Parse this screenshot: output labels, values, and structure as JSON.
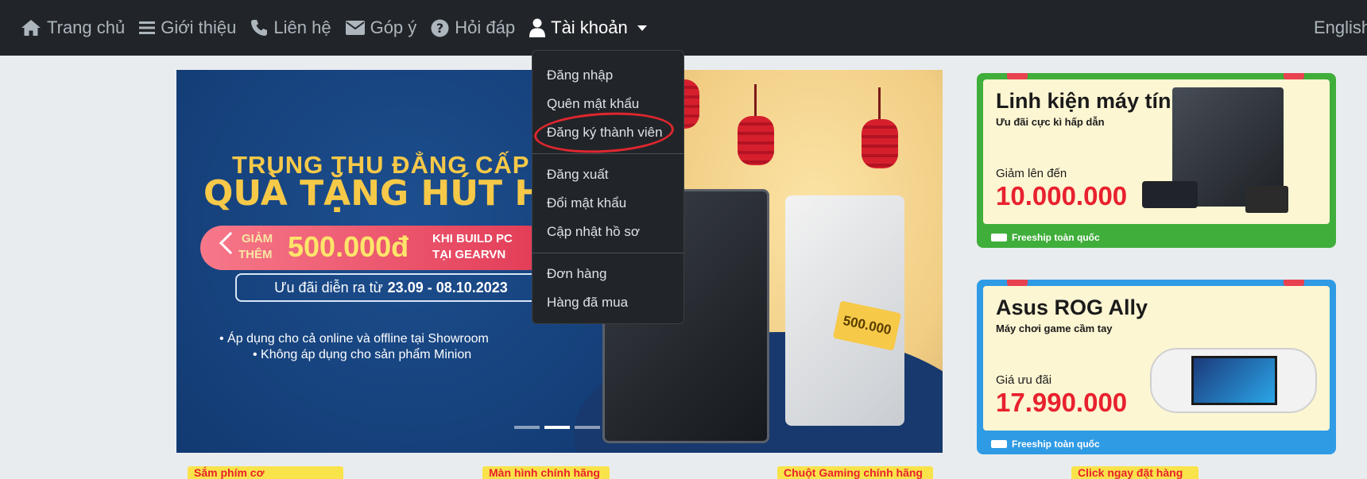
{
  "navbar": {
    "items": [
      {
        "label": "Trang chủ",
        "icon": "home-icon"
      },
      {
        "label": "Giới thiệu",
        "icon": "list-icon"
      },
      {
        "label": "Liên hệ",
        "icon": "phone-icon"
      },
      {
        "label": "Góp ý",
        "icon": "envelope-icon"
      },
      {
        "label": "Hỏi đáp",
        "icon": "question-circle-icon"
      }
    ],
    "account": {
      "label": "Tài khoản",
      "icon": "user-icon"
    },
    "language": "English"
  },
  "dropdown": {
    "group1": [
      "Đăng nhập",
      "Quên mật khẩu",
      "Đăng ký thành viên"
    ],
    "group2": [
      "Đăng xuất",
      "Đổi mật khẩu",
      "Cập nhật hồ sơ"
    ],
    "group3": [
      "Đơn hàng",
      "Hàng đã mua"
    ]
  },
  "banner": {
    "line1": "TRUNG THU ĐẲNG CẤP",
    "line2": "QUÀ TẶNG HÚT HỒ",
    "giam": "GIẢM",
    "them": "THÊM",
    "amount": "500.000đ",
    "khi_build": "KHI BUILD PC",
    "tai_gearvn": "TẠI GEARVN",
    "date_label": "Ưu đãi diễn ra từ",
    "date_range": "23.09 - 08.10.2023",
    "bullet1": "• Áp dụng cho cả online và offline tại Showroom",
    "bullet2": "• Không áp dụng cho sản phẩm Minion",
    "tag": "500.000"
  },
  "cards": [
    {
      "title": "Linh kiện máy tính",
      "subtitle": "Ưu đãi cực kì hấp dẫn",
      "price_label": "Giảm lên đến",
      "price": "10.000.000",
      "ship": "Freeship toàn quốc"
    },
    {
      "title": "Asus ROG Ally",
      "subtitle": "Máy chơi game cầm tay",
      "price_label": "Giá ưu đãi",
      "price": "17.990.000",
      "ship": "Freeship toàn quốc"
    }
  ],
  "strip": [
    "Sắm phím cơ",
    "Màn hình chính hãng",
    "Chuột Gaming chính hãng",
    "Click ngay đặt hàng"
  ],
  "colors": {
    "navbar": "#212529",
    "annotation": "#e0262e",
    "card1_border": "#3fae3a",
    "card2_border": "#2f9be5"
  }
}
